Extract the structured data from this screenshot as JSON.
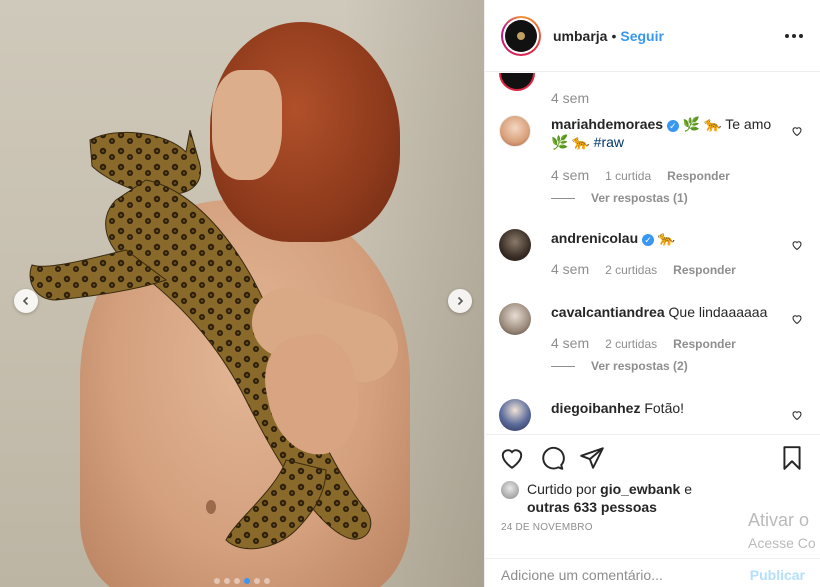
{
  "post": {
    "username": "umbarja",
    "separator": "•",
    "follow_label": "Seguir",
    "more_label": "•••"
  },
  "comments": {
    "top_time": "4 sem",
    "items": [
      {
        "username": "mariahdemoraes",
        "text_before": "🌿 🐆 Te amo",
        "text_line2": "🌿 🐆",
        "hashtag": "#raw",
        "time": "4 sem",
        "likes": "1 curtida",
        "reply": "Responder",
        "replies": "Ver respostas (1)"
      },
      {
        "username": "andrenicolau",
        "text": "🐆",
        "time": "4 sem",
        "likes": "2 curtidas",
        "reply": "Responder"
      },
      {
        "username": "cavalcantiandrea",
        "text": "Que lindaaaaaa",
        "time": "4 sem",
        "likes": "2 curtidas",
        "reply": "Responder",
        "replies": "Ver respostas (2)"
      },
      {
        "username": "diegoibanhez",
        "text": "Fotão!"
      }
    ]
  },
  "likes": {
    "prefix": "Curtido por",
    "user": "gio_ewbank",
    "conj": "e",
    "others": "outras 633 pessoas"
  },
  "date": "24 DE NOVEMBRO",
  "add_comment": {
    "placeholder": "Adicione um comentário...",
    "publish": "Publicar"
  },
  "carousel": {
    "slide_count": 6,
    "active_index": 3
  },
  "watermark": {
    "line1": "Ativar o",
    "line2": "Acesse Co"
  },
  "colors": {
    "accent": "#3897f0",
    "muted": "#8e8e8e",
    "text": "#262626"
  }
}
